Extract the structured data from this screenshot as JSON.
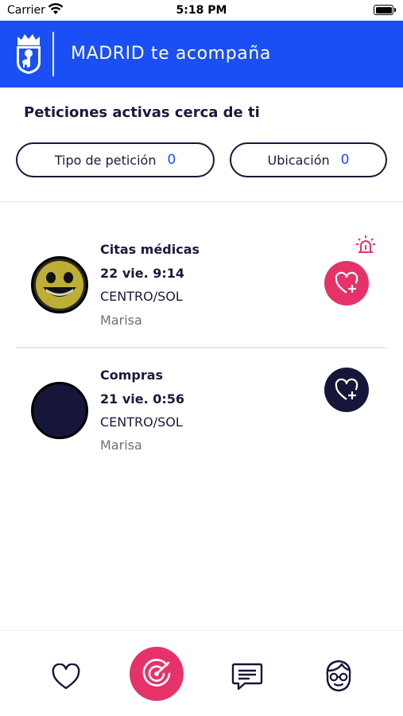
{
  "status_bar": {
    "carrier": "Carrier",
    "time": "5:18 PM"
  },
  "header": {
    "title": "MADRID te acompaña",
    "logo_icon": "madrid-coat-of-arms-icon",
    "background_color": "#1a4ff5"
  },
  "section": {
    "title": "Peticiones activas cerca de ti"
  },
  "filters": {
    "type": {
      "label": "Tipo de petición",
      "count": "0"
    },
    "location": {
      "label": "Ubicación",
      "count": "0"
    }
  },
  "requests": [
    {
      "category": "Citas médicas",
      "date": "22 vie. 9:14",
      "location": "CENTRO/SOL",
      "user": "Marisa",
      "urgent": true,
      "button_color": "#e5336a"
    },
    {
      "category": "Compras",
      "date": "21 vie. 0:56",
      "location": "CENTRO/SOL",
      "user": "Marisa",
      "urgent": false,
      "button_color": "#16163a"
    }
  ],
  "bottom_nav": {
    "items": [
      "heart-icon",
      "radar-icon",
      "chat-icon",
      "profile-icon"
    ],
    "active": "radar-icon",
    "active_color": "#e5336a"
  },
  "colors": {
    "accent": "#1a4ff5",
    "urgent": "#e5336a",
    "dark": "#16163a"
  }
}
